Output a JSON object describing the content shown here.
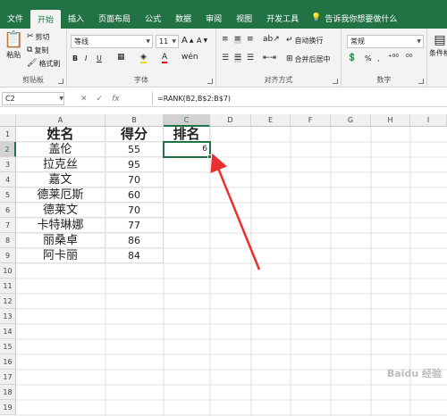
{
  "tabs": [
    "文件",
    "开始",
    "插入",
    "页面布局",
    "公式",
    "数据",
    "审阅",
    "视图",
    "开发工具"
  ],
  "active_tab": "开始",
  "tell_me": "告诉我你想要做什么",
  "clipboard": {
    "paste": "粘贴",
    "cut": "剪切",
    "copy": "复制",
    "format_painter": "格式刷",
    "label": "剪贴板"
  },
  "font": {
    "name": "等线",
    "size": "11",
    "label": "字体",
    "bold": "B",
    "italic": "I",
    "underline": "U",
    "grow": "A",
    "shrink": "A"
  },
  "alignment": {
    "wrap": "自动换行",
    "merge": "合并后居中",
    "label": "对齐方式"
  },
  "number": {
    "format": "常规",
    "label": "数字",
    "percent": "%",
    "comma": ","
  },
  "styles": {
    "conditional": "条件格"
  },
  "formula_bar": {
    "name_box": "C2",
    "cancel": "✕",
    "enter": "✓",
    "fx": "fx",
    "formula": "=RANK(B2,B$2:B$7)"
  },
  "columns": [
    "A",
    "B",
    "C",
    "D",
    "E",
    "F",
    "G",
    "H",
    "I"
  ],
  "rows": [
    "1",
    "2",
    "3",
    "4",
    "5",
    "6",
    "7",
    "8",
    "9",
    "10",
    "11",
    "12",
    "13",
    "14",
    "15",
    "16",
    "17",
    "18",
    "19"
  ],
  "table": {
    "headers": [
      "姓名",
      "得分",
      "排名"
    ],
    "names": [
      "盖伦",
      "拉克丝",
      "嘉文",
      "德莱厄斯",
      "德莱文",
      "卡特琳娜",
      "丽桑卓",
      "阿卡丽"
    ],
    "scores": [
      "55",
      "95",
      "70",
      "60",
      "70",
      "77",
      "86",
      "84"
    ],
    "rank": "6"
  },
  "watermark": "Baidu 经验",
  "colors": {
    "brand": "#217346",
    "arrow": "#e8312f"
  }
}
